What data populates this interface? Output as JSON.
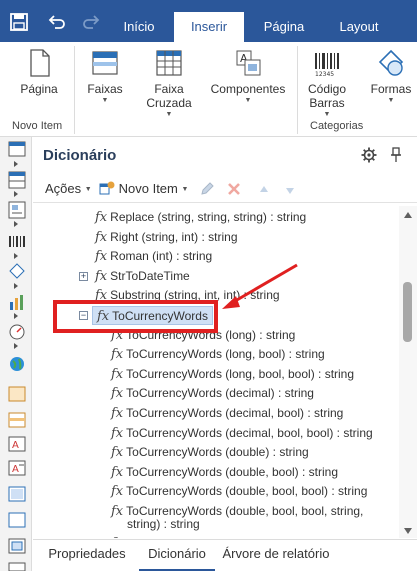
{
  "titlebar": {
    "tabs": [
      "Início",
      "Inserir",
      "Página",
      "Layout"
    ],
    "active_tab": "Inserir",
    "accent": "#2b579a"
  },
  "ribbon": {
    "buttons": [
      {
        "label": "Página",
        "icon": "page-icon",
        "dropdown": false
      },
      {
        "label": "Faixas",
        "icon": "bands-icon",
        "dropdown": true
      },
      {
        "label": "Faixa Cruzada",
        "icon": "cross-band-icon",
        "dropdown": true
      },
      {
        "label": "Componentes",
        "icon": "components-icon",
        "dropdown": true
      },
      {
        "label": "Código Barras",
        "icon": "barcode-icon",
        "dropdown": true
      },
      {
        "label": "Formas",
        "icon": "shapes-icon",
        "dropdown": true
      }
    ],
    "groups": [
      "Novo Item",
      "Categorias"
    ]
  },
  "panel": {
    "title": "Dicionário",
    "toolbar": {
      "actions_label": "Ações",
      "new_item_label": "Novo Item"
    }
  },
  "tree": {
    "items": [
      {
        "text": "Replace (string, string, string) : string"
      },
      {
        "text": "Right (string, int) : string"
      },
      {
        "text": "Roman (int) : string"
      },
      {
        "text": "StrToDateTime",
        "expander": "+"
      },
      {
        "text": "Substring (string, int, int) : string"
      },
      {
        "text": "ToCurrencyWords",
        "expander": "−",
        "selected": true
      },
      {
        "text": "ToCurrencyWords (long) : string"
      },
      {
        "text": "ToCurrencyWords (long, bool) : string"
      },
      {
        "text": "ToCurrencyWords (long, bool, bool) : string"
      },
      {
        "text": "ToCurrencyWords (decimal) : string"
      },
      {
        "text": "ToCurrencyWords (decimal, bool) : string"
      },
      {
        "text": "ToCurrencyWords (decimal, bool, bool) : string"
      },
      {
        "text": "ToCurrencyWords (double) : string"
      },
      {
        "text": "ToCurrencyWords (double, bool) : string"
      },
      {
        "text": "ToCurrencyWords (double, bool, bool) : string"
      },
      {
        "text": "ToCurrencyWords (double, bool, bool, string,",
        "continuation": "string) : string"
      },
      {
        "text": "ToCurrencyWordsAr (double, string, string) : string"
      }
    ],
    "fx_symbol": "fx"
  },
  "bottom_tabs": {
    "tabs": [
      "Propriedades",
      "Dicionário",
      "Árvore de relatório"
    ],
    "active": "Dicionário"
  },
  "annotation": {
    "highlight_color": "#e02020"
  }
}
